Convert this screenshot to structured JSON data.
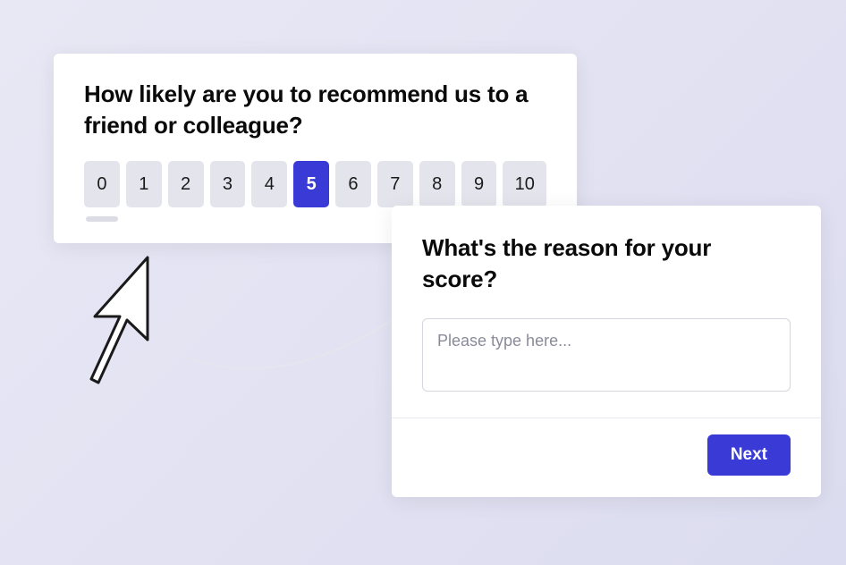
{
  "nps": {
    "question": "How likely are you to recommend us to a friend or colleague?",
    "options": [
      "0",
      "1",
      "2",
      "3",
      "4",
      "5",
      "6",
      "7",
      "8",
      "9",
      "10"
    ],
    "selected_value": "5"
  },
  "reason": {
    "question": "What's the reason for your score?",
    "placeholder": "Please type here...",
    "value": ""
  },
  "buttons": {
    "next": "Next"
  },
  "colors": {
    "accent": "#3a3ad6",
    "button_bg": "#e4e4ec",
    "page_bg": "#e4e4f2"
  }
}
